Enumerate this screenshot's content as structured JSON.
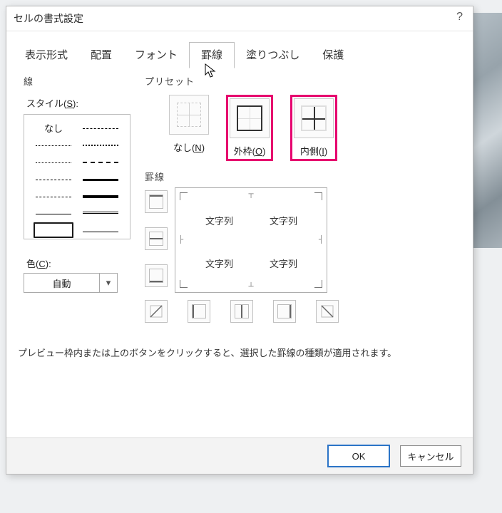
{
  "dialog": {
    "title": "セルの書式設定",
    "help": "?"
  },
  "tabs": {
    "display": "表示形式",
    "alignment": "配置",
    "font": "フォント",
    "border": "罫線",
    "fill": "塗りつぶし",
    "protection": "保護"
  },
  "line": {
    "group": "線",
    "style_label": "スタイル(S):",
    "none": "なし",
    "color_label": "色(C):",
    "color_value": "自動"
  },
  "presets": {
    "group": "プリセット",
    "none": "なし(N)",
    "outside": "外枠(O)",
    "inside": "内側(I)"
  },
  "border": {
    "group": "罫線"
  },
  "preview": {
    "cells": [
      "文字列",
      "文字列",
      "文字列",
      "文字列"
    ]
  },
  "hint": "プレビュー枠内または上のボタンをクリックすると、選択した罫線の種類が適用されます。",
  "buttons": {
    "ok": "OK",
    "cancel": "キャンセル"
  }
}
